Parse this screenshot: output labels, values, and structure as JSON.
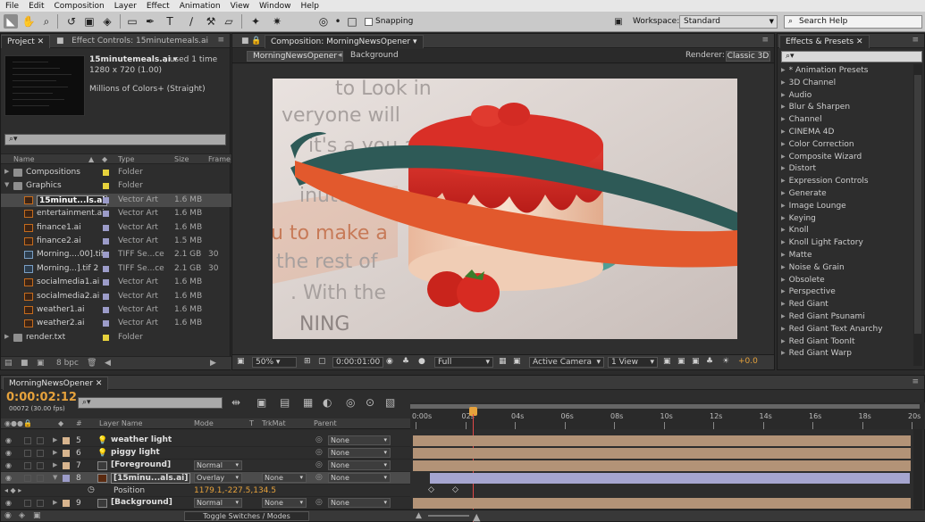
{
  "menu": [
    "File",
    "Edit",
    "Composition",
    "Layer",
    "Effect",
    "Animation",
    "View",
    "Window",
    "Help"
  ],
  "toolbar": {
    "snapping_label": "Snapping",
    "workspace_label": "Workspace:",
    "workspace_value": "Standard",
    "search_help": "Search Help"
  },
  "project": {
    "tabs": [
      "Project",
      "Effect Controls: 15minutemeals.ai"
    ],
    "asset_name": "15minutemeals.ai ▾",
    "asset_used": ", used 1 time",
    "asset_dims": "1280 x 720 (1.00)",
    "asset_colors": "Millions of Colors+ (Straight)",
    "search_placeholder": "⌕▾",
    "columns": {
      "name": "Name",
      "type": "Type",
      "size": "Size",
      "frame": "Frame"
    },
    "items": [
      {
        "name": "Compositions",
        "type": "Folder",
        "size": "",
        "frame": "",
        "kind": "folder",
        "indent": 0,
        "tri": "▶",
        "label_color": "#e6d13c"
      },
      {
        "name": "Graphics",
        "type": "Folder",
        "size": "",
        "frame": "",
        "kind": "folder",
        "indent": 0,
        "tri": "▼",
        "label_color": "#e6d13c"
      },
      {
        "name": "15minut...ls.ai",
        "type": "Vector Art",
        "size": "1.6 MB",
        "frame": "",
        "kind": "ai",
        "indent": 1,
        "tri": "",
        "label_color": "#9c9cc9",
        "selected": true
      },
      {
        "name": "entertainment.ai",
        "type": "Vector Art",
        "size": "1.6 MB",
        "frame": "",
        "kind": "ai",
        "indent": 1,
        "tri": "",
        "label_color": "#9c9cc9"
      },
      {
        "name": "finance1.ai",
        "type": "Vector Art",
        "size": "1.6 MB",
        "frame": "",
        "kind": "ai",
        "indent": 1,
        "tri": "",
        "label_color": "#9c9cc9"
      },
      {
        "name": "finance2.ai",
        "type": "Vector Art",
        "size": "1.5 MB",
        "frame": "",
        "kind": "ai",
        "indent": 1,
        "tri": "",
        "label_color": "#9c9cc9"
      },
      {
        "name": "Morning....00].tif",
        "type": "TIFF Se...ce",
        "size": "2.1 GB",
        "frame": "30",
        "kind": "tif",
        "indent": 1,
        "tri": "",
        "label_color": "#9c9cc9"
      },
      {
        "name": "Morning...].tif 2",
        "type": "TIFF Se...ce",
        "size": "2.1 GB",
        "frame": "30",
        "kind": "tif",
        "indent": 1,
        "tri": "",
        "label_color": "#9c9cc9"
      },
      {
        "name": "socialmedia1.ai",
        "type": "Vector Art",
        "size": "1.6 MB",
        "frame": "",
        "kind": "ai",
        "indent": 1,
        "tri": "",
        "label_color": "#9c9cc9"
      },
      {
        "name": "socialmedia2.ai",
        "type": "Vector Art",
        "size": "1.6 MB",
        "frame": "",
        "kind": "ai",
        "indent": 1,
        "tri": "",
        "label_color": "#9c9cc9"
      },
      {
        "name": "weather1.ai",
        "type": "Vector Art",
        "size": "1.6 MB",
        "frame": "",
        "kind": "ai",
        "indent": 1,
        "tri": "",
        "label_color": "#9c9cc9"
      },
      {
        "name": "weather2.ai",
        "type": "Vector Art",
        "size": "1.6 MB",
        "frame": "",
        "kind": "ai",
        "indent": 1,
        "tri": "",
        "label_color": "#9c9cc9"
      },
      {
        "name": "render.txt",
        "type": "Folder",
        "size": "",
        "frame": "",
        "kind": "folder",
        "indent": 0,
        "tri": "▶",
        "label_color": "#e6d13c"
      }
    ],
    "bpc": "8 bpc"
  },
  "composition": {
    "tab": "Composition: MorningNewsOpener",
    "crumbs": [
      "MorningNewsOpener",
      "Background"
    ],
    "renderer_label": "Renderer:",
    "renderer_value": "Classic 3D",
    "zoom": "50%",
    "timecode": "0:00:01:00",
    "resolution": "Full",
    "camera": "Active Camera",
    "view": "1 View",
    "exposure": "+0.0",
    "bg_text": [
      "to Look in",
      "veryone will",
      "it's a you a",
      "inutes",
      "u to make a",
      "the rest of",
      ". With the",
      "NING"
    ]
  },
  "effects": {
    "tab": "Effects & Presets",
    "search_placeholder": "⌕▾",
    "items": [
      "* Animation Presets",
      "3D Channel",
      "Audio",
      "Blur & Sharpen",
      "Channel",
      "CINEMA 4D",
      "Color Correction",
      "Composite Wizard",
      "Distort",
      "Expression Controls",
      "Generate",
      "Image Lounge",
      "Keying",
      "Knoll",
      "Knoll Light Factory",
      "Matte",
      "Noise & Grain",
      "Obsolete",
      "Perspective",
      "Red Giant",
      "Red Giant Psunami",
      "Red Giant Text Anarchy",
      "Red Giant ToonIt",
      "Red Giant Warp"
    ]
  },
  "timeline": {
    "tab": "MorningNewsOpener",
    "time": "0:00:02:12",
    "frame_info": "00072 (30.00 fps)",
    "search_placeholder": "⌕▾",
    "columns": {
      "layer_name": "Layer Name",
      "mode": "Mode",
      "t": "T",
      "trkmat": "TrkMat",
      "parent": "Parent"
    },
    "ruler_labels": [
      "0:00s",
      "02s",
      "04s",
      "06s",
      "08s",
      "10s",
      "12s",
      "14s",
      "16s",
      "18s",
      "20s"
    ],
    "layers": [
      {
        "num": "5",
        "name": "weather light",
        "mode": "",
        "trkmat": "",
        "parent": "None",
        "type": "light",
        "label_color": "#d7b48e",
        "bar_color": "#b39377"
      },
      {
        "num": "6",
        "name": "piggy light",
        "mode": "",
        "trkmat": "",
        "parent": "None",
        "type": "light",
        "label_color": "#d7b48e",
        "bar_color": "#b39377"
      },
      {
        "num": "7",
        "name": "[Foreground]",
        "mode": "Normal",
        "trkmat": "",
        "parent": "None",
        "type": "comp",
        "label_color": "#d7b48e",
        "bar_color": "#b39377"
      },
      {
        "num": "8",
        "name": "[15minu...als.ai]",
        "mode": "Overlay",
        "trkmat": "None",
        "parent": "None",
        "type": "ai",
        "label_color": "#9c9cc9",
        "bar_color": "#a5a5cf",
        "selected": true
      },
      {
        "num": "9",
        "name": "[Background]",
        "mode": "Normal",
        "trkmat": "None",
        "parent": "None",
        "type": "comp",
        "label_color": "#d7b48e",
        "bar_color": "#b39377"
      }
    ],
    "position_label": "Position",
    "position_value": "1179.1,-227.5,134.5",
    "toggle_label": "Toggle Switches / Modes"
  }
}
